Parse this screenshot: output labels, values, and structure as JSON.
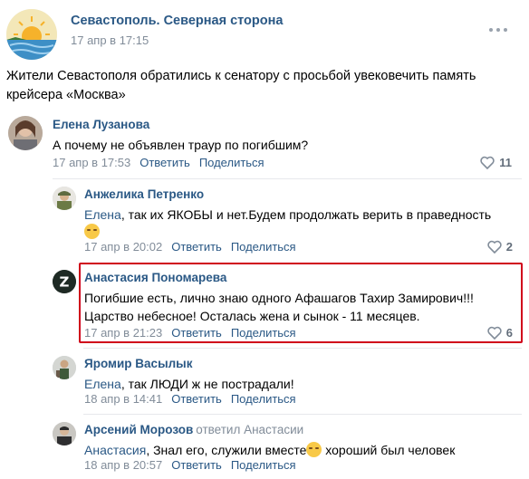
{
  "post": {
    "group_name": "Севастополь. Северная сторона",
    "date": "17 апр в 17:15",
    "text": "Жители Севастополя обратились к сенатору с просьбой увековечить память крейсера «Москва»"
  },
  "actions": {
    "reply": "Ответить",
    "share": "Поделиться"
  },
  "comments": [
    {
      "author": "Елена Лузанова",
      "text": "А почему не объявлен траур по погибшим?",
      "date": "17 апр в 17:53",
      "likes": "11"
    },
    {
      "author": "Анжелика Петренко",
      "mention": "Елена",
      "text": ", так их ЯКОБЫ и нет.Будем продолжать верить в праведность",
      "date": "17 апр в 20:02",
      "likes": "2"
    },
    {
      "author": "Анастасия Пономарева",
      "text": "Погибшие есть, лично знаю одного Афашагов Тахир Замирович!!!",
      "text2": "Царство небесное! Осталась жена и сынок - 11 месяцев.",
      "date": "17 апр в 21:23",
      "likes": "6"
    },
    {
      "author": "Яромир Васылык",
      "mention": "Елена",
      "text": ", так ЛЮДИ ж не пострадали!",
      "date": "18 апр в 14:41"
    },
    {
      "author": "Арсений Морозов",
      "replied_to": "ответил Анастасии",
      "mention": "Анастасия",
      "text": ", Знал его, служили вместе",
      "text_after": " хороший был человек",
      "date": "18 апр в 20:57"
    }
  ],
  "colors": {
    "link": "#2a5885",
    "muted": "#818c99",
    "highlight": "#d0021b"
  }
}
